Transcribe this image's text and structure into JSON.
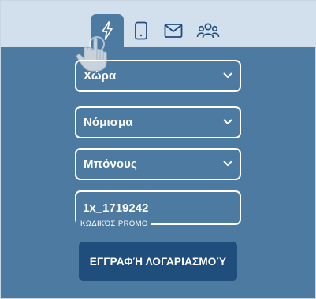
{
  "tabs": [
    {
      "icon": "lightning-icon",
      "active": true
    },
    {
      "icon": "tablet-icon",
      "active": false
    },
    {
      "icon": "envelope-icon",
      "active": false
    },
    {
      "icon": "group-icon",
      "active": false
    }
  ],
  "form": {
    "country": {
      "value": "Χώρα"
    },
    "currency": {
      "value": "Νόμισμα"
    },
    "bonus": {
      "value": "Μπόνους"
    },
    "promo": {
      "value": "1x_1719242",
      "label": "ΚΩΔΙΚΌΣ PROMO"
    },
    "submit_label": "ΕΓΓΡΑΦΉ ΛΟΓΑΡΙΑΣΜΟΎ"
  },
  "colors": {
    "background": "#4d7aa1",
    "tab_bar": "#d2dfec",
    "tab_icon": "#1f4d7c",
    "button": "#1f4d7c",
    "text": "#ffffff"
  }
}
